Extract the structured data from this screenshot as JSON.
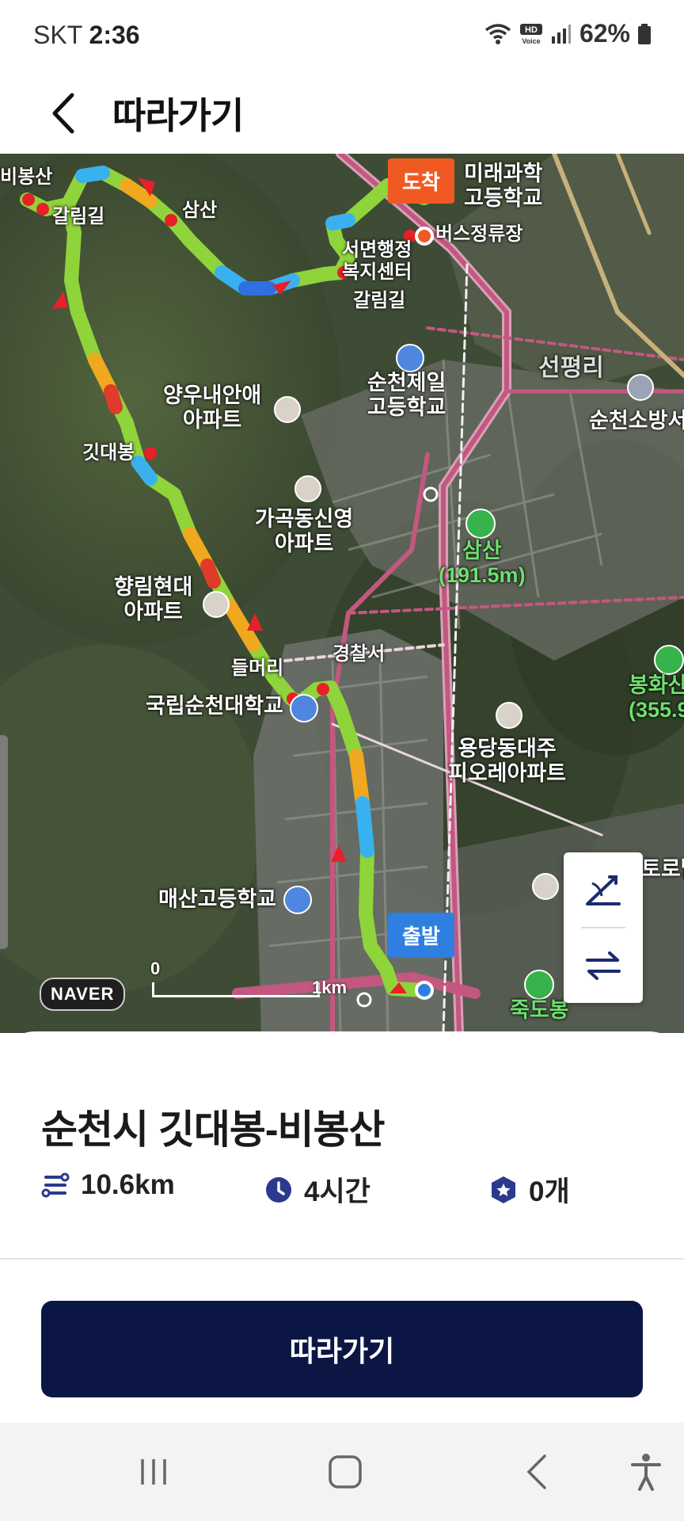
{
  "status": {
    "carrier": "SKT",
    "time": "2:36",
    "battery": "62%"
  },
  "appbar": {
    "title": "따라가기"
  },
  "map": {
    "labels": {
      "bibong_left": "비봉산",
      "galrim_top": "갈림길",
      "samsan_peak": "삼산",
      "arrive": "도착",
      "mirae": "미래과학",
      "mirae2": "고등학교",
      "bus_stop": "버스정류장",
      "seomyeon": "서면행정",
      "seomyeon2": "복지센터",
      "galrim_mid": "갈림길",
      "seonpyeongri": "선평리",
      "sunchon_fire": "순천소방서",
      "yangwoo": "양우내안애",
      "yangwoo2": "아파트",
      "sunchon_jeil": "순천제일",
      "sunchon_jeil2": "고등학교",
      "gitdaebong": "깃대봉",
      "gagok": "가곡동신영",
      "gagok2": "아파트",
      "samsan_mt": "삼산",
      "samsan_height": "(191.5m)",
      "hyangrim": "향림현대",
      "hyangrim2": "아파트",
      "police": "경찰서",
      "deulmeori": "들머리",
      "bonghwa": "봉화산",
      "bonghwa_height": "(355.9",
      "university": "국립순천대학교",
      "yongdang": "용당동대주",
      "yongdang2": "피오레아파트",
      "maesan": "매산고등학교",
      "depart": "출발",
      "jukdobong": "죽도봉",
      "toroba": "토로발",
      "naver": "NAVER",
      "scale_zero": "0",
      "scale_km": "1km"
    }
  },
  "route": {
    "name": "순천시 깃대봉-비봉산",
    "distance": "10.6km",
    "duration": "4시간",
    "stamps": "0개"
  },
  "cta": {
    "follow_label": "따라가기"
  },
  "colors": {
    "primary": "#0c1645",
    "arrive": "#f05a22",
    "depart": "#2e7fe0",
    "accent_icon": "#2b3a8c"
  }
}
